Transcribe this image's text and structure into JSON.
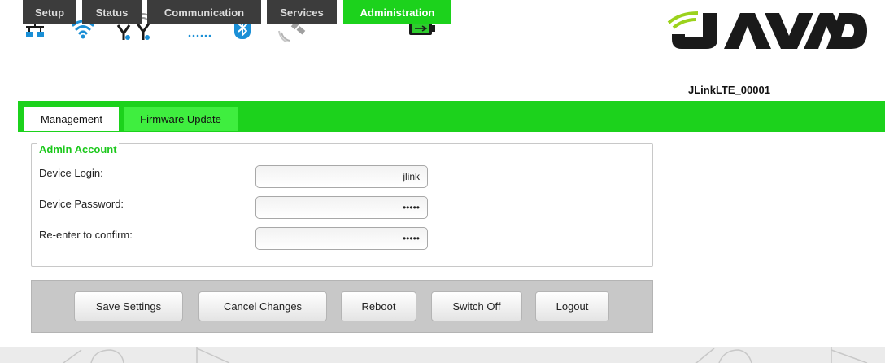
{
  "status_icons": [
    {
      "name": "network-icon",
      "color": "#1a8fd6"
    },
    {
      "name": "wifi-icon",
      "color": "#1a8fd6"
    },
    {
      "name": "cellular-antenna-icon",
      "color": "#1a1a1a"
    },
    {
      "name": "dots-icon",
      "color": "#1a8fd6"
    },
    {
      "name": "bluetooth-icon",
      "color": "#1a8fd6"
    },
    {
      "name": "satellite-icon",
      "color": "#9a9a9a"
    },
    {
      "name": "battery-icon",
      "color": "#22b422"
    }
  ],
  "brand": {
    "logo_text": "JAVAD",
    "logo_color": "#1a1a1a",
    "accent": "#9bd21c"
  },
  "main_tabs": [
    {
      "label": "Setup",
      "active": false
    },
    {
      "label": "Status",
      "active": false
    },
    {
      "label": "Communication",
      "active": false
    },
    {
      "label": "Services",
      "active": false
    },
    {
      "label": "Administration",
      "active": true
    }
  ],
  "device_name": "JLinkLTE_00001",
  "sub_tabs": [
    {
      "label": "Management",
      "active": true
    },
    {
      "label": "Firmware Update",
      "active": false
    }
  ],
  "admin_account": {
    "legend": "Admin Account",
    "fields": [
      {
        "label": "Device Login:",
        "value": "jlink",
        "type": "text"
      },
      {
        "label": "Device Password:",
        "value": "•••••",
        "type": "password"
      },
      {
        "label": "Re-enter to confirm:",
        "value": "•••••",
        "type": "password"
      }
    ]
  },
  "buttons": [
    {
      "label": "Save Settings"
    },
    {
      "label": "Cancel Changes"
    },
    {
      "label": "Reboot"
    },
    {
      "label": "Switch Off"
    },
    {
      "label": "Logout"
    }
  ],
  "colors": {
    "accent_green": "#1cd21c",
    "tab_dark": "#3c3c3c"
  }
}
